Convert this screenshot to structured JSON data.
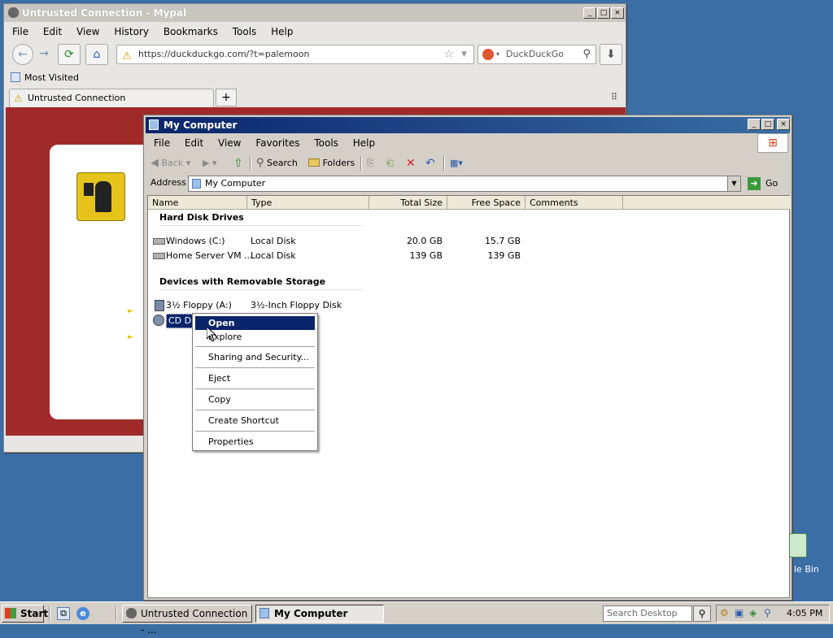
{
  "browser": {
    "title": "Untrusted Connection - Mypal",
    "menu": [
      "File",
      "Edit",
      "View",
      "History",
      "Bookmarks",
      "Tools",
      "Help"
    ],
    "url": "https://duckduckgo.com/?t=palemoon",
    "search_engine": "DuckDuckGo",
    "bookmark": "Most Visited",
    "tab_label": "Untrusted Connection",
    "new_tab": "+"
  },
  "explorer": {
    "title": "My Computer",
    "menu": [
      "File",
      "Edit",
      "View",
      "Favorites",
      "Tools",
      "Help"
    ],
    "toolbar": {
      "back": "Back",
      "search": "Search",
      "folders": "Folders"
    },
    "address_label": "Address",
    "address_value": "My Computer",
    "go_label": "Go",
    "columns": [
      "Name",
      "Type",
      "Total Size",
      "Free Space",
      "Comments"
    ],
    "group_hdd": "Hard Disk Drives",
    "group_removable": "Devices with Removable Storage",
    "drives": [
      {
        "name": "Windows (C:)",
        "type": "Local Disk",
        "total": "20.0 GB",
        "free": "15.7 GB"
      },
      {
        "name": "Home Server VM ...",
        "type": "Local Disk",
        "total": "139 GB",
        "free": "139 GB"
      }
    ],
    "removable": [
      {
        "name": "3½ Floppy (A:)",
        "type": "3½-Inch Floppy Disk"
      },
      {
        "name": "CD Driv"
      }
    ]
  },
  "context_menu": [
    "Open",
    "Explore",
    "Sharing and Security...",
    "Eject",
    "Copy",
    "Create Shortcut",
    "Properties"
  ],
  "desktop": {
    "recycle_label": "le Bin"
  },
  "taskbar": {
    "start": "Start",
    "task1": "Untrusted Connection - ...",
    "task2": "My Computer",
    "search_placeholder": "Search Desktop",
    "clock": "4:05 PM"
  }
}
